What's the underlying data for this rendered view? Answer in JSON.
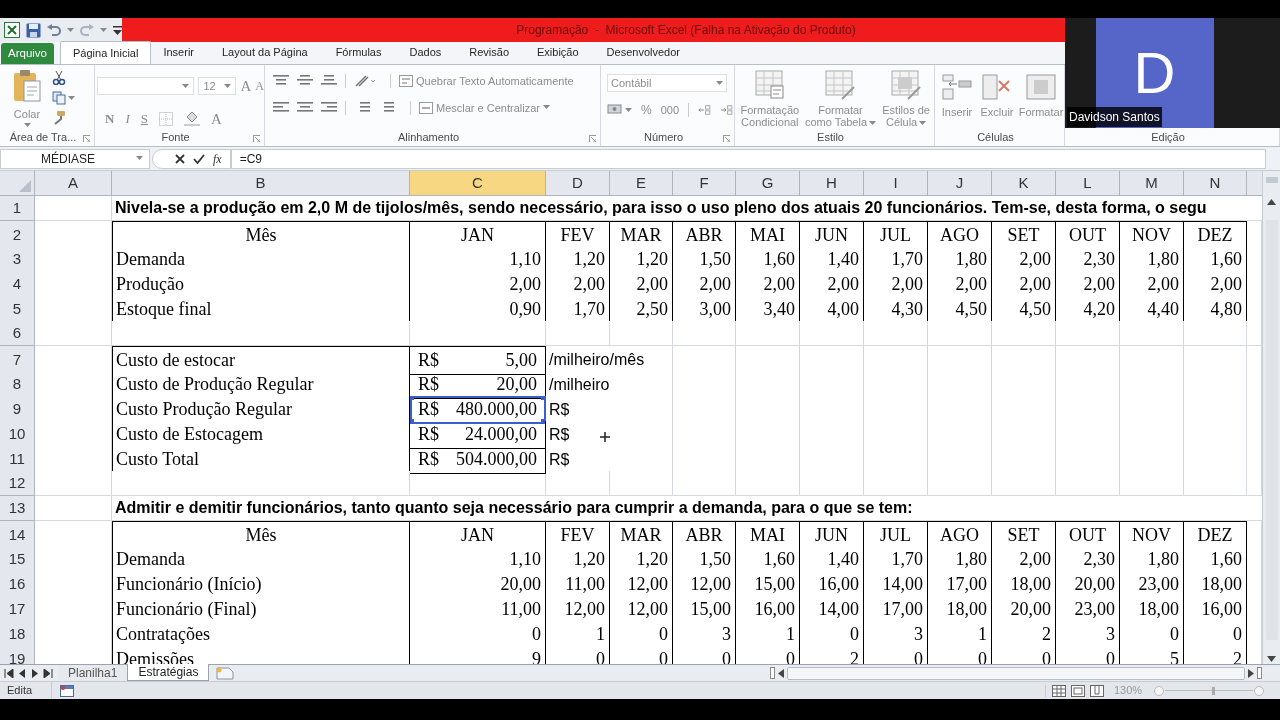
{
  "window": {
    "title": "Programação  -  Microsoft Excel (Falha na Ativação do Produto)"
  },
  "ribbon_tabs": [
    {
      "label": "Arquivo",
      "kind": "file",
      "selected": false
    },
    {
      "label": "Página Inicial",
      "kind": "tab",
      "selected": true
    },
    {
      "label": "Inserir",
      "kind": "tab",
      "selected": false
    },
    {
      "label": "Layout da Página",
      "kind": "tab",
      "selected": false
    },
    {
      "label": "Fórmulas",
      "kind": "tab",
      "selected": false
    },
    {
      "label": "Dados",
      "kind": "tab",
      "selected": false
    },
    {
      "label": "Revisão",
      "kind": "tab",
      "selected": false
    },
    {
      "label": "Exibição",
      "kind": "tab",
      "selected": false
    },
    {
      "label": "Desenvolvedor",
      "kind": "tab",
      "selected": false
    }
  ],
  "ribbon": {
    "disabled": true,
    "clipboard": {
      "label": "Área de Tra...",
      "paste": "Colar"
    },
    "font": {
      "label": "Fonte",
      "size": "12",
      "grow": "A",
      "shrink": "A",
      "bold": "N",
      "italic": "I",
      "underline": "S",
      "color_letter": "A"
    },
    "alignment": {
      "label": "Alinhamento",
      "wrap": "Quebrar Texto Automaticamente",
      "merge": "Mesclar e Centralizar"
    },
    "number": {
      "label": "Número",
      "format": "Contábil",
      "percent": "%",
      "thousands": "000"
    },
    "styles": {
      "label": "Estilo",
      "conditional": "Formatação Condicional",
      "as_table": "Formatar como Tabela",
      "cell_styles": "Estilos de Célula"
    },
    "cells": {
      "label": "Células",
      "insert": "Inserir",
      "delete": "Excluir",
      "format": "Formatar"
    },
    "editing": {
      "label": "Edição"
    }
  },
  "video_overlay": {
    "initial": "D",
    "name": "Davidson Santos"
  },
  "formula_bar": {
    "name_box": "MÉDIASE",
    "function_label": "fx",
    "formula": "=C9"
  },
  "sheet": {
    "columns": [
      {
        "letter": "A",
        "selected": false
      },
      {
        "letter": "B",
        "selected": false
      },
      {
        "letter": "C",
        "selected": true
      },
      {
        "letter": "D",
        "selected": false
      },
      {
        "letter": "E",
        "selected": false
      },
      {
        "letter": "F",
        "selected": false
      },
      {
        "letter": "G",
        "selected": false
      },
      {
        "letter": "H",
        "selected": false
      },
      {
        "letter": "I",
        "selected": false
      },
      {
        "letter": "J",
        "selected": false
      },
      {
        "letter": "K",
        "selected": false
      },
      {
        "letter": "L",
        "selected": false
      },
      {
        "letter": "M",
        "selected": false
      },
      {
        "letter": "N",
        "selected": false
      }
    ],
    "rows": [
      {
        "number": "1",
        "kind": "title",
        "text": "Nivela-se a produção em 2,0 M de tijolos/mês, sendo necessário, para isso o uso pleno dos atuais 20 funcionários. Tem-se, desta forma, o segu"
      },
      {
        "number": "2",
        "kind": "header",
        "label": "Mês",
        "values": [
          "JAN",
          "FEV",
          "MAR",
          "ABR",
          "MAI",
          "JUN",
          "JUL",
          "AGO",
          "SET",
          "OUT",
          "NOV",
          "DEZ"
        ]
      },
      {
        "number": "3",
        "kind": "data",
        "label": "Demanda",
        "values": [
          "1,10",
          "1,20",
          "1,20",
          "1,50",
          "1,60",
          "1,40",
          "1,70",
          "1,80",
          "2,00",
          "2,30",
          "1,80",
          "1,60"
        ]
      },
      {
        "number": "4",
        "kind": "data",
        "label": "Produção",
        "values": [
          "2,00",
          "2,00",
          "2,00",
          "2,00",
          "2,00",
          "2,00",
          "2,00",
          "2,00",
          "2,00",
          "2,00",
          "2,00",
          "2,00"
        ]
      },
      {
        "number": "5",
        "kind": "data",
        "label": "Estoque final",
        "values": [
          "0,90",
          "1,70",
          "2,50",
          "3,00",
          "3,40",
          "4,00",
          "4,30",
          "4,50",
          "4,50",
          "4,20",
          "4,40",
          "4,80"
        ]
      },
      {
        "number": "6",
        "kind": "blank"
      },
      {
        "number": "7",
        "kind": "cost",
        "label": "Custo de estocar",
        "currency": "R$",
        "amount": "5,00",
        "note": "/milheiro/mês",
        "selected": false
      },
      {
        "number": "8",
        "kind": "cost",
        "label": "Custo de Produção Regular",
        "currency": "R$",
        "amount": "20,00",
        "note": "/milheiro",
        "selected": false
      },
      {
        "number": "9",
        "kind": "cost",
        "label": "Custo Produção Regular",
        "currency": "R$",
        "amount": "480.000,00",
        "note": "R$",
        "selected": true
      },
      {
        "number": "10",
        "kind": "cost",
        "label": "Custo de Estocagem",
        "currency": "R$",
        "amount": "24.000,00",
        "note": "R$",
        "selected": false
      },
      {
        "number": "11",
        "kind": "cost",
        "label": "Custo Total",
        "currency": "R$",
        "amount": "504.000,00",
        "note": "R$",
        "selected": false
      },
      {
        "number": "12",
        "kind": "blank"
      },
      {
        "number": "13",
        "kind": "title",
        "text": "Admitir e demitir funcionários, tanto quanto seja necessário para cumprir a demanda, para o que se tem:"
      },
      {
        "number": "14",
        "kind": "header",
        "label": "Mês",
        "values": [
          "JAN",
          "FEV",
          "MAR",
          "ABR",
          "MAI",
          "JUN",
          "JUL",
          "AGO",
          "SET",
          "OUT",
          "NOV",
          "DEZ"
        ]
      },
      {
        "number": "15",
        "kind": "data",
        "label": "Demanda",
        "values": [
          "1,10",
          "1,20",
          "1,20",
          "1,50",
          "1,60",
          "1,40",
          "1,70",
          "1,80",
          "2,00",
          "2,30",
          "1,80",
          "1,60"
        ]
      },
      {
        "number": "16",
        "kind": "data",
        "label": "Funcionário (Início)",
        "values": [
          "20,00",
          "11,00",
          "12,00",
          "12,00",
          "15,00",
          "16,00",
          "14,00",
          "17,00",
          "18,00",
          "20,00",
          "23,00",
          "18,00"
        ]
      },
      {
        "number": "17",
        "kind": "data",
        "label": "Funcionário (Final)",
        "values": [
          "11,00",
          "12,00",
          "12,00",
          "15,00",
          "16,00",
          "14,00",
          "17,00",
          "18,00",
          "20,00",
          "23,00",
          "18,00",
          "16,00"
        ]
      },
      {
        "number": "18",
        "kind": "data",
        "label": "Contratações",
        "values": [
          "0",
          "1",
          "0",
          "3",
          "1",
          "0",
          "3",
          "1",
          "2",
          "3",
          "0",
          "0"
        ]
      },
      {
        "number": "19",
        "kind": "data",
        "label": "Demissões",
        "values": [
          "9",
          "0",
          "0",
          "0",
          "0",
          "2",
          "0",
          "0",
          "0",
          "0",
          "5",
          "2"
        ]
      }
    ]
  },
  "sheet_tabs": [
    {
      "label": "Planilha1",
      "selected": false
    },
    {
      "label": "Estratégias",
      "selected": true
    }
  ],
  "status_bar": {
    "mode": "Edita",
    "zoom": "130%",
    "zoom_slider": {
      "level": 0.55
    }
  }
}
